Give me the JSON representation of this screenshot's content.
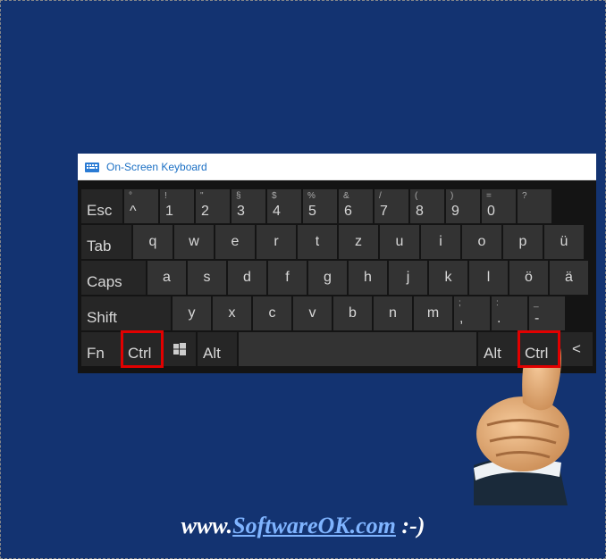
{
  "window": {
    "title": "On-Screen Keyboard"
  },
  "rows": {
    "r0": {
      "esc": "Esc",
      "k1": {
        "sup": "°",
        "main": "^"
      },
      "k2": {
        "sup": "!",
        "main": "1"
      },
      "k3": {
        "sup": "\"",
        "main": "2"
      },
      "k4": {
        "sup": "§",
        "main": "3"
      },
      "k5": {
        "sup": "$",
        "main": "4"
      },
      "k6": {
        "sup": "%",
        "main": "5"
      },
      "k7": {
        "sup": "&",
        "main": "6"
      },
      "k8": {
        "sup": "/",
        "main": "7"
      },
      "k9": {
        "sup": "(",
        "main": "8"
      },
      "k10": {
        "sup": ")",
        "main": "9"
      },
      "k11": {
        "sup": "=",
        "main": "0"
      },
      "k12": {
        "sup": "?",
        "main": ""
      }
    },
    "r1": {
      "tab": "Tab",
      "keys": [
        "q",
        "w",
        "e",
        "r",
        "t",
        "z",
        "u",
        "i",
        "o",
        "p",
        "ü"
      ]
    },
    "r2": {
      "caps": "Caps",
      "keys": [
        "a",
        "s",
        "d",
        "f",
        "g",
        "h",
        "j",
        "k",
        "l",
        "ö",
        "ä"
      ]
    },
    "r3": {
      "shift": "Shift",
      "keys": [
        "y",
        "x",
        "c",
        "v",
        "b",
        "n",
        "m"
      ],
      "semi": {
        "sup": ";",
        "main": ","
      },
      "period": {
        "sup": ":",
        "main": "."
      },
      "dash": {
        "sup": "_",
        "main": "-"
      }
    },
    "r4": {
      "fn": "Fn",
      "ctrl_l": "Ctrl",
      "alt_l": "Alt",
      "alt_r": "Alt",
      "ctrl_r": "Ctrl",
      "back": "<"
    }
  },
  "watermark": {
    "prefix": "www.",
    "link": "SoftwareOK.com",
    "suffix": " :-)"
  },
  "icons": {
    "keyboard": "keyboard-icon",
    "windows": "windows-icon",
    "thumbs_up": "thumbs-up-icon"
  }
}
